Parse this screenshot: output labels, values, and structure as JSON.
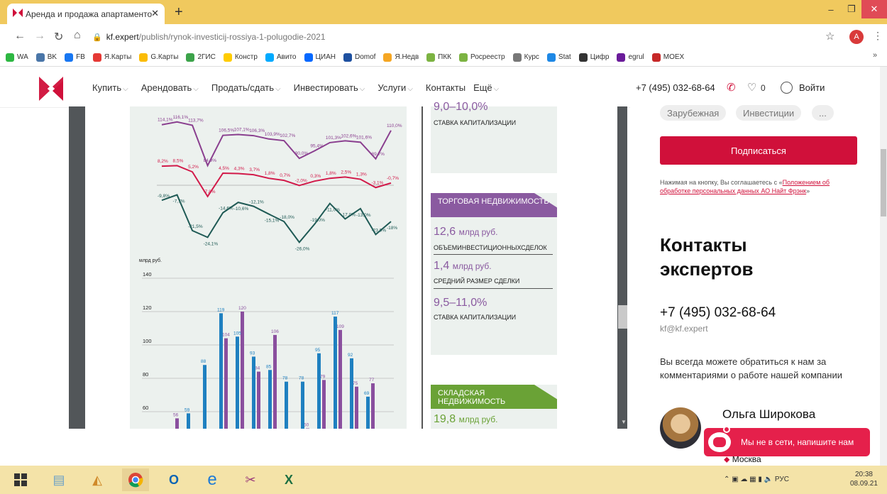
{
  "browser": {
    "tab_title": "Аренда и продажа апартаменто",
    "url_host": "kf.expert",
    "url_path": "/publish/rynok-investicij-rossiya-1-polugodie-2021",
    "profile_initial": "A",
    "bookmarks": [
      {
        "label": "WA",
        "color": "#2db742"
      },
      {
        "label": "BK",
        "color": "#4a76a8"
      },
      {
        "label": "FB",
        "color": "#1877f2"
      },
      {
        "label": "Я.Карты",
        "color": "#e53935"
      },
      {
        "label": "G.Карты",
        "color": "#fbbc05"
      },
      {
        "label": "2ГИС",
        "color": "#3ca34a"
      },
      {
        "label": "Констр",
        "color": "#ffcc00"
      },
      {
        "label": "Авито",
        "color": "#00aaff"
      },
      {
        "label": "ЦИАН",
        "color": "#0468ff"
      },
      {
        "label": "Domof",
        "color": "#1e50a0"
      },
      {
        "label": "Я.Недв",
        "color": "#f5a623"
      },
      {
        "label": "ПКК",
        "color": "#7cb342"
      },
      {
        "label": "Росреестр",
        "color": "#7cb342"
      },
      {
        "label": "Курс",
        "color": "#777"
      },
      {
        "label": "Stat",
        "color": "#1e88e5"
      },
      {
        "label": "Цифр",
        "color": "#333"
      },
      {
        "label": "egrul",
        "color": "#6a1b9a"
      },
      {
        "label": "MOEX",
        "color": "#c62828"
      }
    ]
  },
  "site": {
    "nav": [
      "Купить",
      "Арендовать",
      "Продать/сдать",
      "Инвестировать",
      "Услуги",
      "Контакты",
      "Ещё"
    ],
    "nav_with_caret": [
      true,
      true,
      true,
      true,
      true,
      false,
      true
    ],
    "phone": "+7 (495) 032-68-64",
    "favorites_count": "0",
    "login": "Войти",
    "colors": {
      "brand": "#d0103a",
      "purple": "#8a5aa0",
      "green": "#6aa236"
    }
  },
  "document": {
    "card1": {
      "value": "9,0–10,0%",
      "sub": "СТАВКА КАПИТАЛИЗАЦИИ"
    },
    "card2": {
      "banner": "ТОРГОВАЯ НЕДВИЖИМОСТЬ",
      "v1": "12,6",
      "u1": "млрд руб.",
      "s1": "ОБЪЕМИНВЕСТИЦИОННЫХСДЕЛОК",
      "v2": "1,4",
      "u2": "млрд руб.",
      "s2": "СРЕДНИЙ РАЗМЕР СДЕЛКИ",
      "v3": "9,5–11,0%",
      "s3": "СТАВКА КАПИТАЛИЗАЦИИ"
    },
    "card3": {
      "banner": "СКЛАДСКАЯ НЕДВИЖИМОСТЬ",
      "v1": "19,8",
      "u1": "млрд руб."
    }
  },
  "chart_data": [
    {
      "type": "line",
      "series": [
        {
          "color": "#8a3f8f",
          "labels": [
            "114,1%",
            "116,1%",
            "113,7%",
            "84,9%",
            "106,5%",
            "107,1%",
            "106,3%",
            "103,9%",
            "102,7%",
            "90,0%",
            "95,4%",
            "101,3%",
            "102,6%",
            "101,6%",
            "89,7%",
            "110,0%"
          ],
          "values": [
            114.1,
            116.1,
            113.7,
            84.9,
            106.5,
            107.1,
            106.3,
            103.9,
            102.7,
            90.0,
            95.4,
            101.3,
            102.6,
            101.6,
            89.7,
            110.0
          ]
        },
        {
          "color": "#d21a4a",
          "labels": [
            "8,2%",
            "8,5%",
            "5,2%",
            "-7,8%",
            "4,5%",
            "4,3%",
            "3,7%",
            "1,8%",
            "0,7%",
            "-2,0%",
            "0,3%",
            "1,8%",
            "2,5%",
            "1,3%",
            "-3,1%",
            "-0,7%"
          ],
          "values": [
            8.2,
            8.5,
            5.2,
            -7.8,
            4.5,
            4.3,
            3.7,
            1.8,
            0.7,
            -2.0,
            0.3,
            1.8,
            2.5,
            1.3,
            -3.1,
            -0.7
          ]
        },
        {
          "color": "#1f5a55",
          "labels": [
            "-9,8%",
            "-7,7%",
            "-21,5%",
            "-24,1%",
            "-14,6%",
            "-10,6%",
            "-12,1%",
            "-15,1%",
            "-18,0%",
            "-26,0%",
            "-19,0%",
            "-11,0%",
            "-17,0%",
            "-13,0%",
            "-23,0%",
            "-18%"
          ],
          "values": [
            -9.8,
            -7.7,
            -21.5,
            -24.1,
            -14.6,
            -10.6,
            -12.1,
            -15.1,
            -18.0,
            -26.0,
            -19.0,
            -11.0,
            -17.0,
            -13.0,
            -23.0,
            -18.0
          ]
        }
      ]
    },
    {
      "type": "bar",
      "ylabel": "млрд руб.",
      "yticks": [
        60,
        80,
        100,
        120,
        140
      ],
      "ylim": [
        60,
        140
      ],
      "series": [
        {
          "color": "#8a4f9e",
          "values": [
            56,
            null,
            null,
            104,
            120,
            84,
            106,
            null,
            50,
            79,
            109,
            75,
            77,
            null
          ]
        },
        {
          "color": "#1f80c0",
          "values": [
            null,
            59,
            88,
            119,
            105,
            93,
            85,
            78,
            78,
            95,
            117,
            92,
            69,
            null
          ]
        }
      ]
    }
  ],
  "sidebar": {
    "chips": [
      "Зарубежная",
      "Инвестиции",
      "..."
    ],
    "subscribe": "Подписаться",
    "consent_prefix": "Нажимая на кнопку, Вы соглашаетесь с «",
    "consent_link": "Положением об обработке персональных данных АО Найт Фрэнк",
    "consent_suffix": "»",
    "contacts_title_1": "Контакты",
    "contacts_title_2": "экспертов",
    "phone": "+7 (495) 032-68-64",
    "email": "kf@kf.expert",
    "note": "Вы всегда можете обратиться к нам за комментариями о работе нашей компании",
    "expert_name": "Ольга Широкова",
    "city": "Москва",
    "chat": "Мы не в сети, напишите нам"
  },
  "taskbar": {
    "lang": "РУС",
    "time": "20:38",
    "date": "08.09.21"
  }
}
